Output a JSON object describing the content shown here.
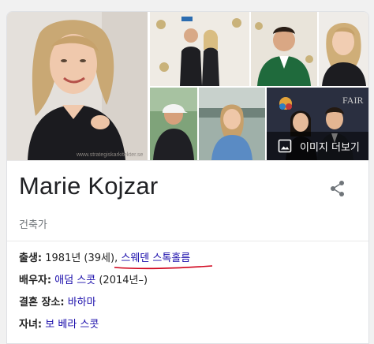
{
  "knowledge_panel": {
    "images": {
      "more_images_label": "이미지 더보기",
      "watermark": "www.strategiskarkitekter.se"
    },
    "title": "Marie Kojzar",
    "subtitle": "건축가",
    "facts": [
      {
        "label": "출생:",
        "text_before": " 1981년 (39세), ",
        "link": "스웨덴 스톡홀름",
        "text_after": ""
      },
      {
        "label": "배우자:",
        "text_before": " ",
        "link": "애덤 스콧",
        "text_after": " (2014년–)"
      },
      {
        "label": "결혼 장소:",
        "text_before": " ",
        "link": "바하마",
        "text_after": ""
      },
      {
        "label": "자녀:",
        "text_before": " ",
        "link": "보 베라 스콧",
        "text_after": ""
      }
    ]
  },
  "colors": {
    "link": "#1a0dab",
    "annotation_underline": "#d0021b",
    "text": "#202124",
    "muted": "#70757a"
  },
  "icons": {
    "share": "share-icon",
    "more_images": "image-icon"
  }
}
